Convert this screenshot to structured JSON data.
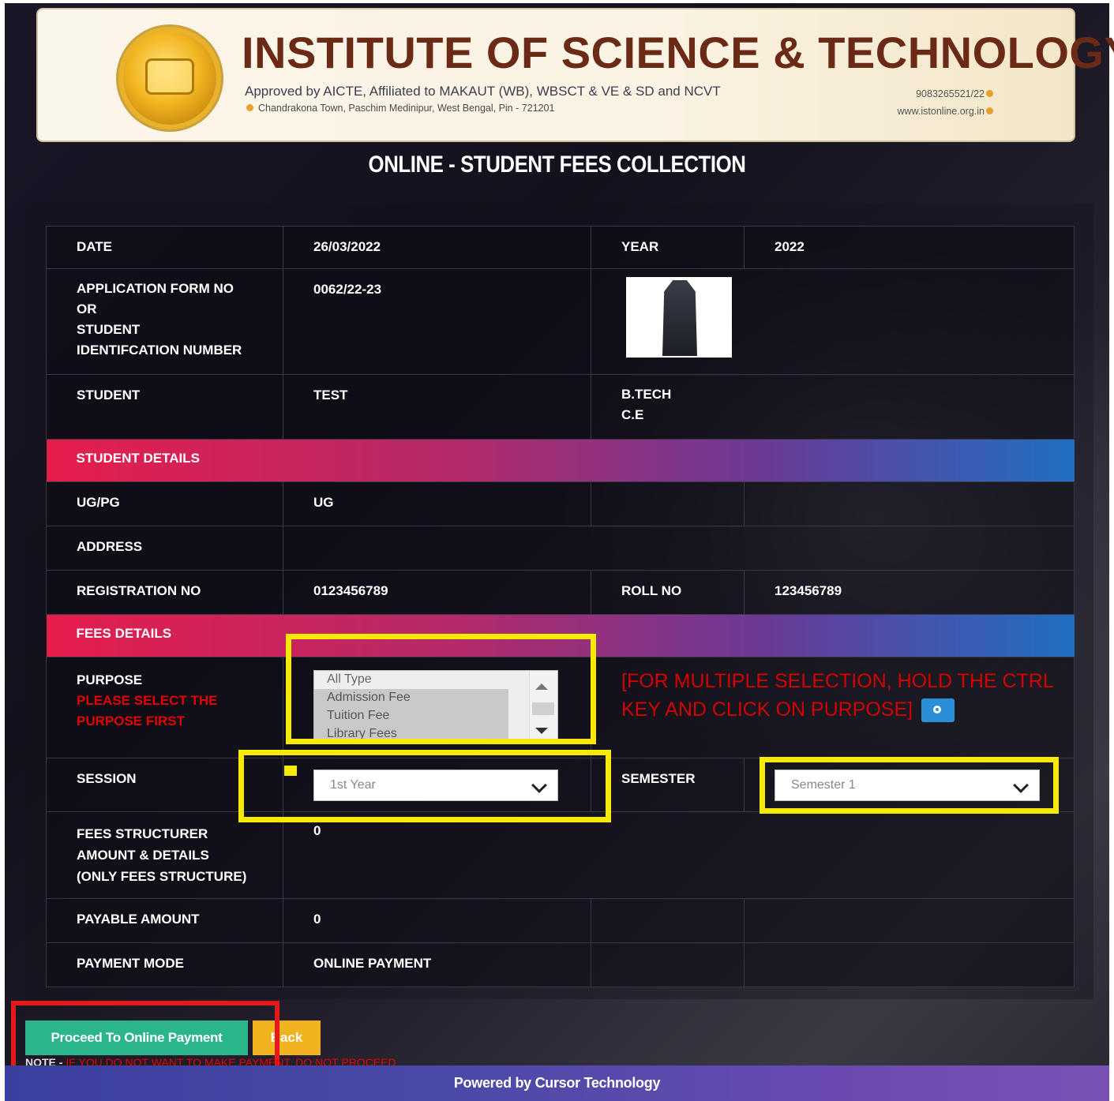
{
  "header": {
    "institute_name": "INSTITUTE OF SCIENCE & TECHNOLOGY",
    "approval": "Approved by AICTE, Affiliated to MAKAUT (WB), WBSCT & VE & SD and NCVT",
    "address": "Chandrakona Town, Paschim Medinipur, West Bengal, Pin - 721201",
    "phone": "9083265521/22",
    "website": "www.istonline.org.in"
  },
  "page_title": "ONLINE - STUDENT FEES COLLECTION",
  "form": {
    "date_label": "DATE",
    "date_value": "26/03/2022",
    "year_label": "YEAR",
    "year_value": "2022",
    "app_label_line1": "APPLICATION FORM NO",
    "app_label_line2": "OR",
    "app_label_line3": "STUDENT",
    "app_label_line4": "IDENTIFCATION NUMBER",
    "app_value": "0062/22-23",
    "student_label": "STUDENT",
    "student_value": "TEST",
    "course": "B.TECH",
    "branch": "C.E",
    "section_student": "STUDENT DETAILS",
    "ugpg_label": "UG/PG",
    "ugpg_value": "UG",
    "address_label": "ADDRESS",
    "address_value": "",
    "reg_label": "REGISTRATION NO",
    "reg_value": "0123456789",
    "roll_label": "ROLL NO",
    "roll_value": "123456789",
    "section_fees": "FEES DETAILS",
    "purpose_label": "PURPOSE",
    "purpose_warning_line1": "PLEASE SELECT THE",
    "purpose_warning_line2": "PURPOSE FIRST",
    "purpose_options": [
      "All Type",
      "Admission Fee",
      "Tuition Fee",
      "Library Fees"
    ],
    "multi_note_line1": "[FOR MULTIPLE SELECTION, HOLD THE CTRL",
    "multi_note_line2": "KEY AND CLICK ON PURPOSE]",
    "session_label": "SESSION",
    "session_value": "1st Year",
    "semester_label": "SEMESTER",
    "semester_value": "Semester 1",
    "fees_struct_line1": "FEES STRUCTURER",
    "fees_struct_line2": "AMOUNT & DETAILS",
    "fees_struct_line3": "(ONLY FEES STRUCTURE)",
    "fees_struct_value": "0",
    "payable_label": "PAYABLE AMOUNT",
    "payable_value": "0",
    "mode_label": "PAYMENT MODE",
    "mode_value": "ONLINE PAYMENT"
  },
  "actions": {
    "proceed_label": "Proceed To Online Payment",
    "back_label": "Back"
  },
  "note": {
    "prefix": "NOTE -",
    "text": "IF YOU DO NOT WANT TO MAKE PAYMENT, DO NOT PROCEED"
  },
  "footer": {
    "text": "Powered by Cursor Technology"
  },
  "colors": {
    "highlight_yellow": "#f6ea00",
    "highlight_red": "#e41a1a",
    "proceed_green": "#2ab58a",
    "back_orange": "#f0b21e"
  }
}
